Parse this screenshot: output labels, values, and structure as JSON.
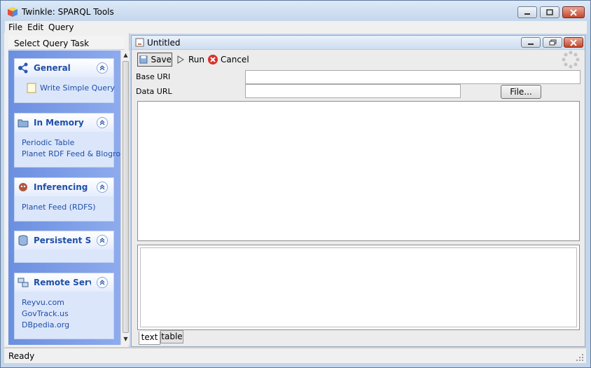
{
  "window": {
    "title": "Twinkle: SPARQL Tools"
  },
  "menubar": {
    "items": [
      "File",
      "Edit",
      "Query"
    ]
  },
  "taskpane": {
    "header": "Select Query Task",
    "groups": [
      {
        "title": "General",
        "icon": "share-graph-icon",
        "items": [
          "Write Simple Query"
        ]
      },
      {
        "title": "In Memory",
        "icon": "folder-icon",
        "items": [
          "Periodic Table",
          "Planet RDF Feed & Blogrol"
        ]
      },
      {
        "title": "Inferencing",
        "icon": "inference-icon",
        "items": [
          "Planet Feed (RDFS)"
        ]
      },
      {
        "title": "Persistent St...",
        "icon": "database-icon",
        "items": []
      },
      {
        "title": "Remote Serv...",
        "icon": "network-icon",
        "items": [
          "Reyvu.com",
          "GovTrack.us",
          "DBpedia.org"
        ]
      }
    ]
  },
  "query_window": {
    "title": "Untitled",
    "toolbar": {
      "save": "Save",
      "run": "Run",
      "cancel": "Cancel"
    },
    "base_uri": {
      "label": "Base URI",
      "value": ""
    },
    "data_url": {
      "label": "Data URL",
      "value": ""
    },
    "file_button": "File...",
    "tabs": [
      "text",
      "table"
    ],
    "active_tab": "text"
  },
  "status": "Ready",
  "colors": {
    "accent": "#1f4fa8",
    "taskpane_bg": "#7b9ce8"
  }
}
